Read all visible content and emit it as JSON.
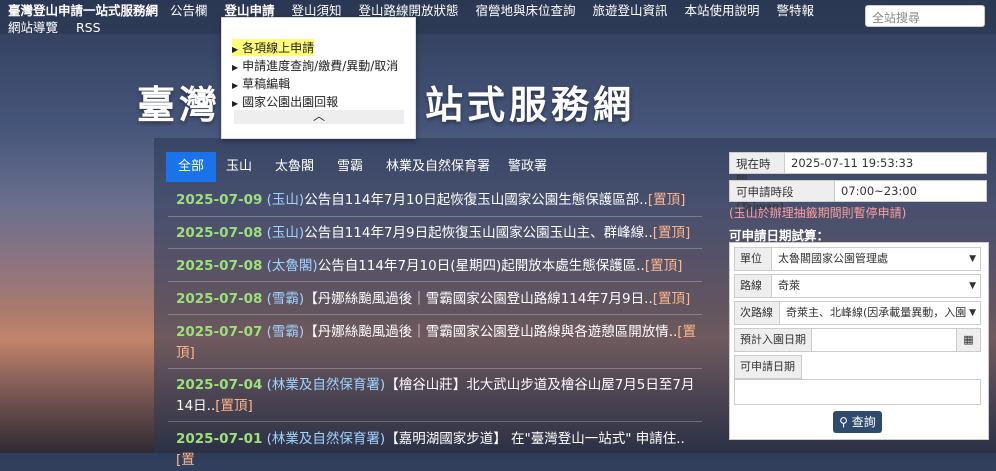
{
  "header": {
    "site_name": "臺灣登山申請一站式服務網",
    "nav": [
      "公告欄",
      "登山申請",
      "登山須知",
      "登山路線開放狀態",
      "宿營地與床位查詢",
      "旅遊登山資訊",
      "本站使用說明",
      "警特報"
    ],
    "nav_row2": [
      "網站導覽",
      "RSS"
    ],
    "search_placeholder": "全站搜尋"
  },
  "dropdown": {
    "items": [
      "各項線上申請",
      "申請進度查詢/繳費/異動/取消",
      "草稿編輯",
      "國家公園出園回報"
    ],
    "collapse": "︿"
  },
  "hero": {
    "left": "臺灣",
    "right": "站式服務網"
  },
  "tabs": [
    "全部",
    "玉山",
    "太魯閣",
    "雪霸",
    "林業及自然保育署",
    "警政署"
  ],
  "news": [
    {
      "date": "2025-07-09",
      "src": "(玉山)",
      "text": "公告自114年7月10日起恢復玉山國家公園生態保護區部..",
      "top": "[置頂]"
    },
    {
      "date": "2025-07-08",
      "src": "(玉山)",
      "text": "公告自114年7月9日起恢復玉山國家公園玉山主、群峰線..",
      "top": "[置頂]"
    },
    {
      "date": "2025-07-08",
      "src": "(太魯閣)",
      "text": "公告自114年7月10日(星期四)起開放本處生態保護區..",
      "top": "[置頂]"
    },
    {
      "date": "2025-07-08",
      "src": "(雪霸)",
      "text": "【丹娜絲颱風過後｜雪霸國家公園登山路線114年7月9日..",
      "top": "[置頂]"
    },
    {
      "date": "2025-07-07",
      "src": "(雪霸)",
      "text": "【丹娜絲颱風過後｜雪霸國家公園登山路線與各遊憩區開放情..",
      "top": "[置頂]"
    },
    {
      "date": "2025-07-04",
      "src": "(林業及自然保育署)",
      "text": "【檜谷山莊】北大武山步道及檜谷山屋7月5日至7月14日..",
      "top": "[置頂]"
    },
    {
      "date": "2025-07-01",
      "src": "(林業及自然保育署)",
      "text": "【嘉明湖國家步道】 在\"臺灣登山一站式\" 申請住..",
      "top": "[置"
    }
  ],
  "sidebar": {
    "now_label": "現在時間",
    "now_value": "2025-07-11 19:53:33",
    "period_label": "可申請時段(Taiwan)",
    "period_value": "07:00~23:00",
    "warning": "(玉山於辦理抽籤期間則暫停申請)",
    "calc_title": "可申請日期試算：",
    "unit_label": "單位",
    "unit_value": "太魯閣國家公園管理處",
    "route_label": "路線",
    "route_value": "奇萊",
    "subroute_label": "次路線",
    "subroute_value": "奇萊主、北峰線(因承載量異動，入園",
    "entry_label": "預計入園日期",
    "entry_value": "",
    "apply_label": "可申請日期",
    "apply_value": "",
    "query_button": "查詢"
  }
}
